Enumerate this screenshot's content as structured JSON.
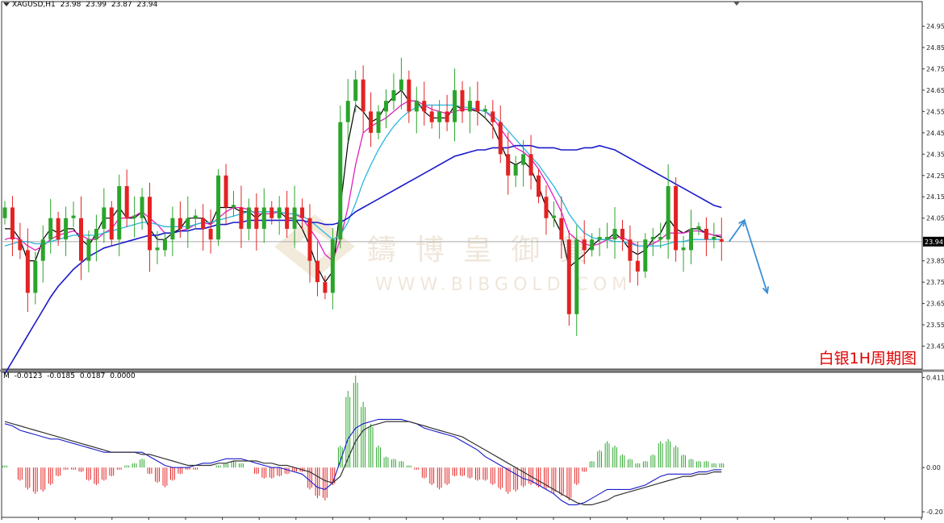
{
  "header": {
    "symbol": "XAGUSD,H1",
    "open": "23.98",
    "high": "23.99",
    "low": "23.87",
    "close": "23.94"
  },
  "period_title": "白银1H周期图",
  "watermark": {
    "cn": "鑄 博 皇 御 貴",
    "url": "WWW.BIBGOLD.COM"
  },
  "macd_header": {
    "name": "M",
    "v1": "-0.0123",
    "v2": "-0.0185",
    "v3": "0.0187",
    "v4": "0.0000"
  },
  "colors": {
    "bull": "#2aa52a",
    "bear": "#e32222",
    "ma_fast": "#000000",
    "ma_mid": "#e020c0",
    "ma_slow": "#29b6e0",
    "ma_long": "#1a1acc",
    "projection": "#3a8fd8",
    "hist_pos": "#2aa52a",
    "hist_neg": "#e32222",
    "macd_line": "#1a1acc",
    "signal_line": "#333333"
  },
  "chart_data": [
    {
      "type": "candlestick",
      "symbol": "XAGUSD",
      "timeframe": "H1",
      "ylim": [
        23.35,
        25.05
      ],
      "y_ticks": [
        "24.95",
        "24.85",
        "24.75",
        "24.65",
        "24.55",
        "24.45",
        "24.35",
        "24.25",
        "24.15",
        "24.05",
        "23.94",
        "23.85",
        "23.75",
        "23.65",
        "23.55",
        "23.45"
      ],
      "current_price": "23.94",
      "close": [
        24.1,
        23.95,
        23.9,
        23.7,
        23.85,
        23.95,
        24.05,
        23.95,
        24.05,
        24.05,
        23.85,
        23.95,
        24.0,
        24.1,
        23.95,
        24.2,
        24.05,
        24.05,
        24.15,
        23.9,
        23.9,
        23.95,
        24.05,
        24.0,
        24.05,
        24.05,
        24.0,
        23.95,
        24.25,
        24.1,
        24.1,
        24.0,
        24.1,
        24.0,
        24.1,
        24.05,
        24.1,
        24.0,
        24.1,
        24.05,
        23.85,
        23.75,
        23.7,
        23.95,
        24.5,
        24.6,
        24.7,
        24.55,
        24.45,
        24.55,
        24.6,
        24.65,
        24.7,
        24.55,
        24.6,
        24.55,
        24.5,
        24.55,
        24.5,
        24.65,
        24.55,
        24.6,
        24.55,
        24.55,
        24.5,
        24.35,
        24.25,
        24.3,
        24.35,
        24.25,
        24.15,
        24.05,
        24.05,
        23.95,
        23.6,
        23.95,
        23.9,
        23.95,
        23.95,
        23.95,
        24.0,
        23.95,
        23.85,
        23.8,
        23.95,
        23.95,
        23.95,
        24.2,
        23.9,
        23.9,
        24.0,
        24.0,
        23.95,
        23.95,
        23.94
      ],
      "highs_lows": {
        "max_high": 24.85,
        "min_low": 23.5
      },
      "moving_averages": [
        {
          "name": "MA fast",
          "values": [
            24.0,
            24.0,
            23.95,
            23.85,
            23.85,
            23.95,
            24.0,
            23.98,
            24.0,
            24.0,
            23.95,
            23.92,
            23.98,
            24.05,
            24.05,
            24.1,
            24.05,
            24.05,
            24.08,
            24.0,
            23.95,
            23.95,
            23.98,
            24.0,
            24.05,
            24.05,
            24.05,
            24.02,
            24.1,
            24.1,
            24.1,
            24.08,
            24.08,
            24.05,
            24.08,
            24.08,
            24.08,
            24.05,
            24.05,
            24.0,
            23.92,
            23.82,
            23.75,
            23.8,
            24.1,
            24.4,
            24.58,
            24.55,
            24.5,
            24.52,
            24.58,
            24.62,
            24.65,
            24.6,
            24.6,
            24.55,
            24.52,
            24.52,
            24.52,
            24.58,
            24.56,
            24.56,
            24.55,
            24.52,
            24.48,
            24.4,
            24.32,
            24.3,
            24.32,
            24.28,
            24.2,
            24.1,
            24.05,
            23.98,
            23.82,
            23.85,
            23.88,
            23.92,
            23.95,
            23.95,
            23.98,
            23.95,
            23.9,
            23.88,
            23.9,
            23.95,
            23.98,
            24.05,
            24.0,
            23.98,
            24.0,
            24.0,
            23.98,
            23.97,
            23.96
          ]
        },
        {
          "name": "MA mid",
          "values": [
            23.95,
            23.96,
            23.95,
            23.92,
            23.9,
            23.92,
            23.95,
            23.97,
            23.98,
            23.99,
            23.97,
            23.95,
            23.95,
            23.98,
            24.0,
            24.05,
            24.05,
            24.06,
            24.08,
            24.05,
            24.02,
            23.98,
            23.98,
            23.99,
            24.0,
            24.02,
            24.03,
            24.02,
            24.05,
            24.08,
            24.1,
            24.1,
            24.09,
            24.07,
            24.07,
            24.07,
            24.08,
            24.07,
            24.07,
            24.05,
            24.0,
            23.95,
            23.88,
            23.85,
            23.95,
            24.1,
            24.3,
            24.45,
            24.48,
            24.5,
            24.52,
            24.55,
            24.58,
            24.6,
            24.6,
            24.58,
            24.56,
            24.55,
            24.54,
            24.55,
            24.56,
            24.56,
            24.56,
            24.55,
            24.52,
            24.47,
            24.42,
            24.38,
            24.36,
            24.33,
            24.28,
            24.22,
            24.15,
            24.08,
            23.98,
            23.95,
            23.93,
            23.92,
            23.93,
            23.95,
            23.96,
            23.96,
            23.94,
            23.92,
            23.92,
            23.93,
            23.95,
            23.98,
            23.98,
            23.98,
            23.99,
            23.99,
            23.98,
            23.97,
            23.97
          ]
        },
        {
          "name": "MA slow",
          "values": [
            23.92,
            23.93,
            23.94,
            23.94,
            23.93,
            23.93,
            23.94,
            23.95,
            23.96,
            23.97,
            23.97,
            23.97,
            23.97,
            23.98,
            23.99,
            24.0,
            24.01,
            24.02,
            24.03,
            24.03,
            24.02,
            24.01,
            24.01,
            24.01,
            24.01,
            24.02,
            24.03,
            24.03,
            24.04,
            24.05,
            24.06,
            24.07,
            24.08,
            24.08,
            24.08,
            24.08,
            24.08,
            24.07,
            24.07,
            24.06,
            24.04,
            24.01,
            23.98,
            23.95,
            23.97,
            24.03,
            24.12,
            24.22,
            24.3,
            24.37,
            24.43,
            24.48,
            24.52,
            24.55,
            24.57,
            24.58,
            24.58,
            24.58,
            24.58,
            24.58,
            24.57,
            24.57,
            24.56,
            24.55,
            24.53,
            24.5,
            24.46,
            24.42,
            24.38,
            24.34,
            24.3,
            24.25,
            24.2,
            24.14,
            24.07,
            24.02,
            23.98,
            23.96,
            23.95,
            23.95,
            23.94,
            23.94,
            23.93,
            23.92,
            23.92,
            23.92,
            23.92,
            23.93,
            23.94,
            23.94,
            23.95,
            23.95,
            23.95,
            23.95,
            23.95
          ]
        },
        {
          "name": "MA long",
          "values": [
            23.32,
            23.38,
            23.44,
            23.5,
            23.56,
            23.62,
            23.68,
            23.73,
            23.77,
            23.81,
            23.84,
            23.87,
            23.89,
            23.91,
            23.92,
            23.93,
            23.94,
            23.95,
            23.96,
            23.97,
            23.97,
            23.98,
            23.98,
            23.99,
            23.99,
            24.0,
            24.0,
            24.01,
            24.02,
            24.02,
            24.03,
            24.03,
            24.04,
            24.04,
            24.04,
            24.04,
            24.04,
            24.04,
            24.04,
            24.04,
            24.03,
            24.03,
            24.02,
            24.02,
            24.03,
            24.05,
            24.08,
            24.1,
            24.12,
            24.14,
            24.16,
            24.18,
            24.2,
            24.22,
            24.24,
            24.26,
            24.28,
            24.3,
            24.32,
            24.34,
            24.35,
            24.36,
            24.37,
            24.37,
            24.38,
            24.38,
            24.38,
            24.39,
            24.39,
            24.39,
            24.38,
            24.38,
            24.38,
            24.37,
            24.37,
            24.37,
            24.38,
            24.38,
            24.39,
            24.38,
            24.37,
            24.35,
            24.33,
            24.31,
            24.29,
            24.27,
            24.25,
            24.23,
            24.21,
            24.19,
            24.17,
            24.15,
            24.13,
            24.11,
            24.1
          ]
        }
      ],
      "projection": [
        {
          "x": 95,
          "y": 23.94
        },
        {
          "x": 97,
          "y": 24.04
        },
        {
          "x": 100,
          "y": 23.7
        }
      ]
    },
    {
      "type": "macd",
      "ylim": [
        -0.22,
        0.42
      ],
      "y_ticks": [
        "0.4112",
        "0.00",
        "-0.2019"
      ],
      "histogram": [
        0.01,
        0.0,
        -0.06,
        -0.1,
        -0.12,
        -0.11,
        -0.08,
        -0.04,
        -0.01,
        -0.01,
        -0.02,
        -0.06,
        -0.08,
        -0.06,
        -0.04,
        -0.01,
        0.01,
        0.02,
        0.04,
        -0.03,
        -0.07,
        -0.09,
        -0.06,
        -0.03,
        -0.01,
        -0.01,
        0.0,
        0.0,
        0.01,
        0.02,
        0.03,
        0.02,
        0.0,
        -0.03,
        -0.05,
        -0.05,
        -0.04,
        -0.03,
        -0.02,
        -0.02,
        -0.1,
        -0.14,
        -0.15,
        -0.08,
        0.1,
        0.35,
        0.42,
        0.3,
        0.2,
        0.1,
        0.05,
        0.04,
        0.03,
        0.01,
        -0.01,
        -0.05,
        -0.08,
        -0.1,
        -0.08,
        -0.04,
        -0.04,
        -0.05,
        -0.06,
        -0.06,
        -0.08,
        -0.1,
        -0.12,
        -0.11,
        -0.09,
        -0.08,
        -0.09,
        -0.1,
        -0.12,
        -0.13,
        -0.15,
        -0.08,
        -0.02,
        0.03,
        0.08,
        0.12,
        0.1,
        0.06,
        0.04,
        0.02,
        0.03,
        0.06,
        0.12,
        0.13,
        0.1,
        0.06,
        0.04,
        0.03,
        0.03,
        0.02,
        0.02
      ],
      "macd_line": [
        0.2,
        0.19,
        0.17,
        0.16,
        0.15,
        0.14,
        0.13,
        0.13,
        0.12,
        0.11,
        0.1,
        0.09,
        0.08,
        0.07,
        0.07,
        0.07,
        0.07,
        0.07,
        0.07,
        0.05,
        0.03,
        0.01,
        0.0,
        0.0,
        0.0,
        0.01,
        0.02,
        0.02,
        0.03,
        0.04,
        0.04,
        0.04,
        0.03,
        0.02,
        0.01,
        0.0,
        0.0,
        -0.01,
        -0.02,
        -0.03,
        -0.06,
        -0.09,
        -0.1,
        -0.07,
        0.03,
        0.13,
        0.18,
        0.2,
        0.21,
        0.22,
        0.22,
        0.22,
        0.22,
        0.21,
        0.2,
        0.18,
        0.17,
        0.16,
        0.15,
        0.14,
        0.12,
        0.1,
        0.08,
        0.05,
        0.03,
        0.01,
        -0.01,
        -0.03,
        -0.05,
        -0.06,
        -0.08,
        -0.1,
        -0.12,
        -0.15,
        -0.17,
        -0.17,
        -0.16,
        -0.14,
        -0.12,
        -0.1,
        -0.1,
        -0.1,
        -0.1,
        -0.09,
        -0.08,
        -0.06,
        -0.04,
        -0.03,
        -0.03,
        -0.03,
        -0.03,
        -0.02,
        -0.02,
        -0.01,
        -0.01
      ],
      "signal_line": [
        0.21,
        0.2,
        0.19,
        0.18,
        0.17,
        0.16,
        0.15,
        0.14,
        0.13,
        0.12,
        0.11,
        0.1,
        0.09,
        0.08,
        0.07,
        0.07,
        0.07,
        0.07,
        0.06,
        0.06,
        0.05,
        0.04,
        0.03,
        0.02,
        0.01,
        0.01,
        0.01,
        0.01,
        0.02,
        0.02,
        0.03,
        0.03,
        0.03,
        0.03,
        0.02,
        0.02,
        0.01,
        0.01,
        0.0,
        -0.01,
        -0.02,
        -0.04,
        -0.06,
        -0.07,
        -0.04,
        0.04,
        0.12,
        0.17,
        0.19,
        0.2,
        0.21,
        0.21,
        0.21,
        0.21,
        0.2,
        0.19,
        0.18,
        0.17,
        0.16,
        0.15,
        0.14,
        0.12,
        0.1,
        0.08,
        0.06,
        0.04,
        0.02,
        0.0,
        -0.02,
        -0.04,
        -0.06,
        -0.08,
        -0.1,
        -0.12,
        -0.14,
        -0.16,
        -0.17,
        -0.17,
        -0.16,
        -0.15,
        -0.13,
        -0.12,
        -0.11,
        -0.1,
        -0.09,
        -0.08,
        -0.07,
        -0.06,
        -0.05,
        -0.04,
        -0.04,
        -0.03,
        -0.03,
        -0.02,
        -0.02
      ]
    }
  ]
}
